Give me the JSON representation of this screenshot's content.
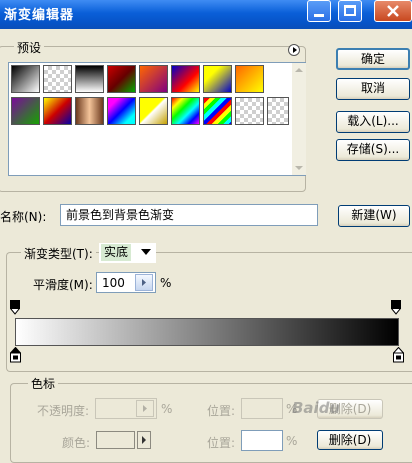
{
  "window": {
    "title": "渐变编辑器"
  },
  "presets": {
    "label": "预设"
  },
  "buttons": {
    "ok": "确定",
    "cancel": "取消",
    "load": "载入(L)...",
    "save": "存储(S)...",
    "new": "新建(W)",
    "delete1": "删除(D)",
    "delete2": "删除(D)"
  },
  "name": {
    "label": "名称(N):",
    "value": "前景色到背景色渐变"
  },
  "gradient_type": {
    "label": "渐变类型(T):",
    "value": "实底"
  },
  "smoothness": {
    "label": "平滑度(M):",
    "value": "100",
    "unit": "%"
  },
  "stops": {
    "label": "色标",
    "opacity_label": "不透明度:",
    "position_label": "位置:",
    "color_label": "颜色:",
    "pct": "%"
  },
  "watermark": "Baidu",
  "colors": {
    "title_bar": "#0a5fd8",
    "dialog_bg": "#ece9d8",
    "input_border": "#7f9db9"
  }
}
